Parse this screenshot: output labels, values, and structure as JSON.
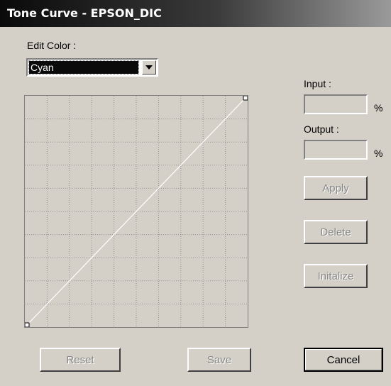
{
  "window": {
    "title": "Tone Curve - EPSON_DIC"
  },
  "edit_color": {
    "label": "Edit Color :",
    "selected": "Cyan"
  },
  "curve": {
    "grid_divisions": 10,
    "points": [
      {
        "input": 0,
        "output": 0
      },
      {
        "input": 100,
        "output": 100
      }
    ],
    "line_color": "#ffffff",
    "grid_color": "#909090"
  },
  "input": {
    "label": "Input :",
    "value": "",
    "unit": "%"
  },
  "output": {
    "label": "Output :",
    "value": "",
    "unit": "%"
  },
  "buttons": {
    "apply": "Apply",
    "delete": "Delete",
    "initialize": "Initalize",
    "reset": "Reset",
    "save": "Save",
    "cancel": "Cancel"
  }
}
